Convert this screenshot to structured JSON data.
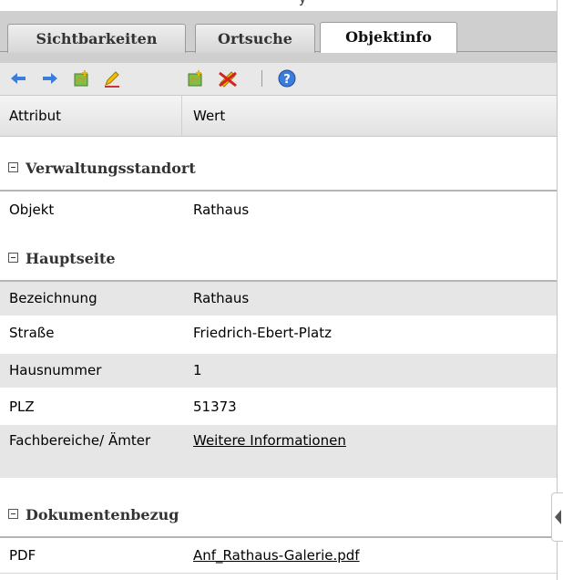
{
  "header_fragment": "y",
  "tabs": [
    {
      "label": "Sichtbarkeiten",
      "active": false
    },
    {
      "label": "Ortsuche",
      "active": false
    },
    {
      "label": "Objektinfo",
      "active": true
    }
  ],
  "toolbar": {
    "icons": [
      "arrow-left-icon",
      "arrow-right-icon",
      "add-map-icon",
      "edit-pencil-icon",
      "map-edit-icon",
      "delete-icon",
      "help-icon"
    ],
    "accent_blue": "#3c7ddc"
  },
  "columns": {
    "attribute": "Attribut",
    "value": "Wert"
  },
  "groups": {
    "verwaltung": {
      "title": "Verwaltungsstandort",
      "rows": [
        {
          "key": "Objekt",
          "value": "Rathaus"
        }
      ]
    },
    "hauptseite": {
      "title": "Hauptseite",
      "rows": [
        {
          "key": "Bezeichnung",
          "value": "Rathaus"
        },
        {
          "key": "Straße",
          "value": "Friedrich-Ebert-Platz"
        },
        {
          "key": "Hausnummer",
          "value": "1"
        },
        {
          "key": "PLZ",
          "value": "51373"
        },
        {
          "key": "Fachbereiche/ Ämter",
          "value": "Weitere Informationen"
        }
      ]
    },
    "dokumente": {
      "title": "Dokumentenbezug",
      "rows": [
        {
          "key": "PDF",
          "value": "Anf_Rathaus-Galerie.pdf"
        }
      ]
    }
  }
}
